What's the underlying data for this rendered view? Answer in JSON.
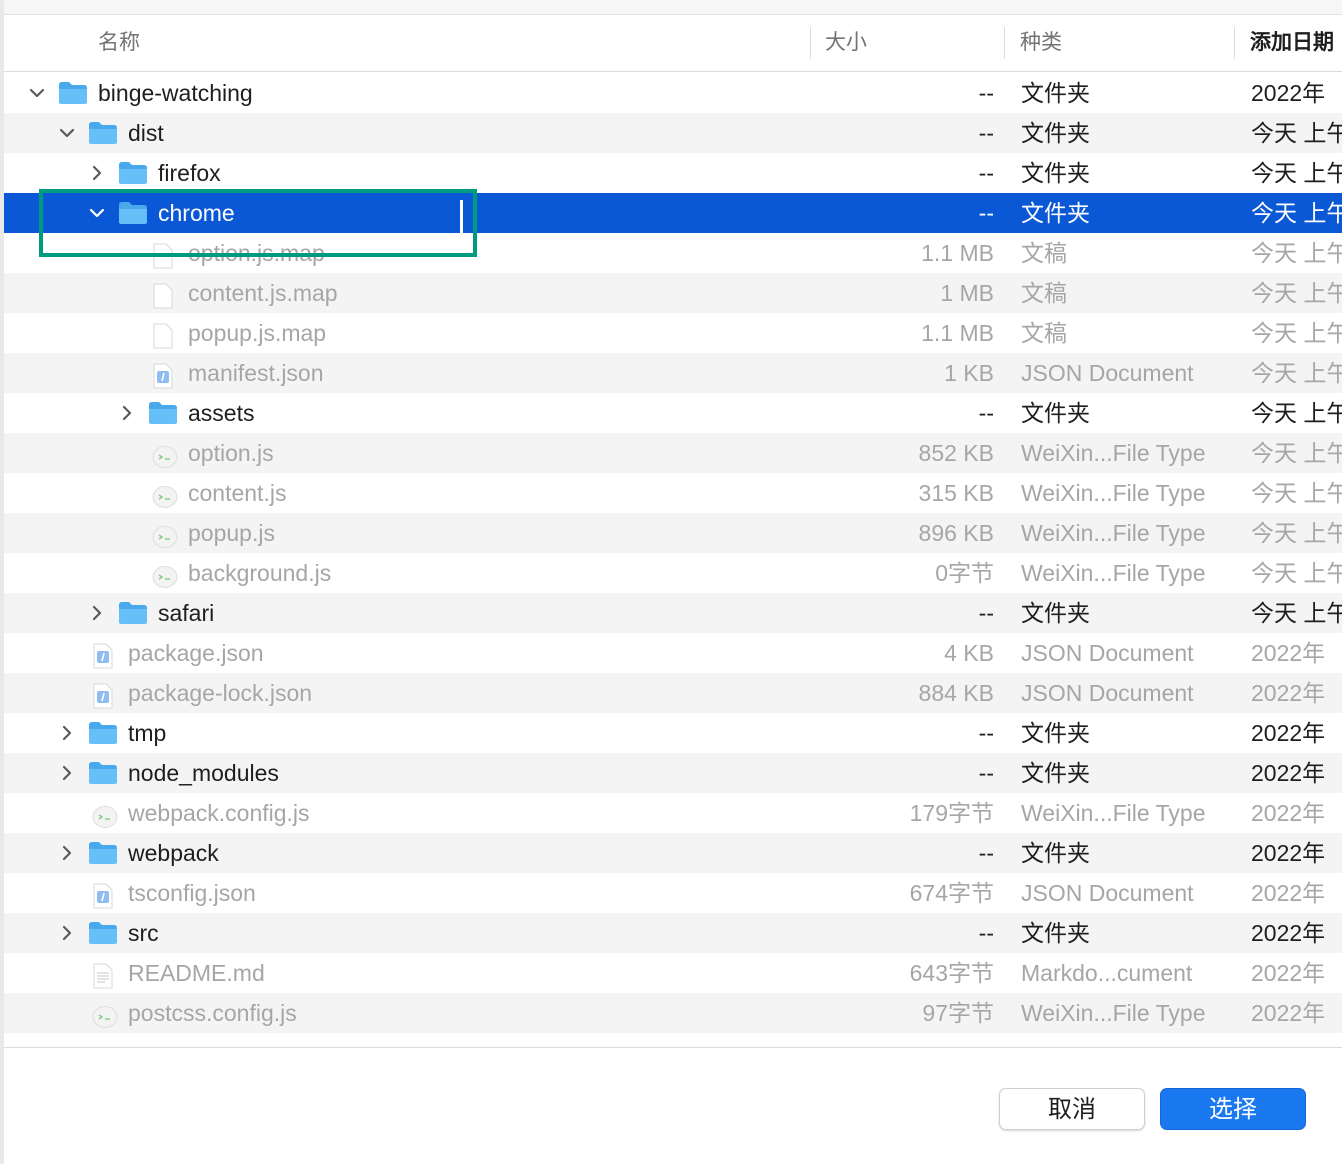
{
  "columns": {
    "name": "名称",
    "size": "大小",
    "kind": "种类",
    "date_added": "添加日期"
  },
  "rows": [
    {
      "name": "binge-watching",
      "size": "--",
      "kind": "文件夹",
      "date": "2022年",
      "level": 0,
      "type": "folder",
      "expanded": true,
      "dim": false
    },
    {
      "name": "dist",
      "size": "--",
      "kind": "文件夹",
      "date": "今天 上午",
      "level": 1,
      "type": "folder",
      "expanded": true,
      "dim": false
    },
    {
      "name": "firefox",
      "size": "--",
      "kind": "文件夹",
      "date": "今天 上午",
      "level": 2,
      "type": "folder",
      "expanded": false,
      "dim": false
    },
    {
      "name": "chrome",
      "size": "--",
      "kind": "文件夹",
      "date": "今天 上午",
      "level": 2,
      "type": "folder",
      "expanded": true,
      "dim": false,
      "selected": true
    },
    {
      "name": "option.js.map",
      "size": "1.1 MB",
      "kind": "文稿",
      "date": "今天 上午",
      "level": 3,
      "type": "doc",
      "dim": true
    },
    {
      "name": "content.js.map",
      "size": "1 MB",
      "kind": "文稿",
      "date": "今天 上午",
      "level": 3,
      "type": "doc",
      "dim": true
    },
    {
      "name": "popup.js.map",
      "size": "1.1 MB",
      "kind": "文稿",
      "date": "今天 上午",
      "level": 3,
      "type": "doc",
      "dim": true
    },
    {
      "name": "manifest.json",
      "size": "1 KB",
      "kind": "JSON Document",
      "date": "今天 上午",
      "level": 3,
      "type": "json",
      "dim": true
    },
    {
      "name": "assets",
      "size": "--",
      "kind": "文件夹",
      "date": "今天 上午",
      "level": 3,
      "type": "folder",
      "expanded": false,
      "dim": false
    },
    {
      "name": "option.js",
      "size": "852 KB",
      "kind": "WeiXin...File Type",
      "date": "今天 上午",
      "level": 3,
      "type": "js",
      "dim": true
    },
    {
      "name": "content.js",
      "size": "315 KB",
      "kind": "WeiXin...File Type",
      "date": "今天 上午",
      "level": 3,
      "type": "js",
      "dim": true
    },
    {
      "name": "popup.js",
      "size": "896 KB",
      "kind": "WeiXin...File Type",
      "date": "今天 上午",
      "level": 3,
      "type": "js",
      "dim": true
    },
    {
      "name": "background.js",
      "size": "0字节",
      "kind": "WeiXin...File Type",
      "date": "今天 上午",
      "level": 3,
      "type": "js",
      "dim": true
    },
    {
      "name": "safari",
      "size": "--",
      "kind": "文件夹",
      "date": "今天 上午",
      "level": 2,
      "type": "folder",
      "expanded": false,
      "dim": false
    },
    {
      "name": "package.json",
      "size": "4 KB",
      "kind": "JSON Document",
      "date": "2022年",
      "level": 1,
      "type": "json",
      "dim": true
    },
    {
      "name": "package-lock.json",
      "size": "884 KB",
      "kind": "JSON Document",
      "date": "2022年",
      "level": 1,
      "type": "json",
      "dim": true
    },
    {
      "name": "tmp",
      "size": "--",
      "kind": "文件夹",
      "date": "2022年",
      "level": 1,
      "type": "folder",
      "expanded": false,
      "dim": false
    },
    {
      "name": "node_modules",
      "size": "--",
      "kind": "文件夹",
      "date": "2022年",
      "level": 1,
      "type": "folder",
      "expanded": false,
      "dim": false
    },
    {
      "name": "webpack.config.js",
      "size": "179字节",
      "kind": "WeiXin...File Type",
      "date": "2022年",
      "level": 1,
      "type": "js",
      "dim": true
    },
    {
      "name": "webpack",
      "size": "--",
      "kind": "文件夹",
      "date": "2022年",
      "level": 1,
      "type": "folder",
      "expanded": false,
      "dim": false
    },
    {
      "name": "tsconfig.json",
      "size": "674字节",
      "kind": "JSON Document",
      "date": "2022年",
      "level": 1,
      "type": "json",
      "dim": true
    },
    {
      "name": "src",
      "size": "--",
      "kind": "文件夹",
      "date": "2022年",
      "level": 1,
      "type": "folder",
      "expanded": false,
      "dim": false
    },
    {
      "name": "README.md",
      "size": "643字节",
      "kind": "Markdo...cument",
      "date": "2022年",
      "level": 1,
      "type": "md",
      "dim": true
    },
    {
      "name": "postcss.config.js",
      "size": "97字节",
      "kind": "WeiXin...File Type",
      "date": "2022年",
      "level": 1,
      "type": "js",
      "dim": true
    }
  ],
  "buttons": {
    "cancel": "取消",
    "choose": "选择"
  },
  "colors": {
    "selection": "#0a58d6",
    "folder": "#5cb8f5",
    "highlight_box": "#009a7e",
    "primary_button": "#1a78f0"
  }
}
